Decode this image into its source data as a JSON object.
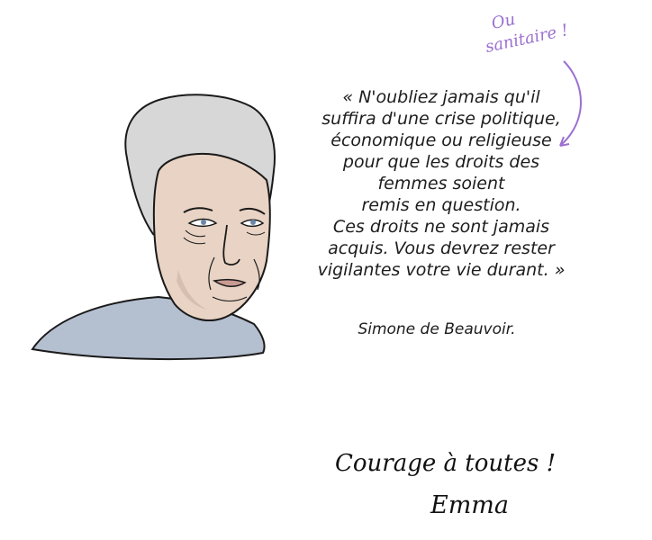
{
  "annotation": {
    "line1": "Ou",
    "line2": "sanitaire !"
  },
  "quote": {
    "lines": [
      "« N'oubliez jamais qu'il",
      "suffira d'une crise politique,",
      "économique ou religieuse",
      "pour que les droits des",
      "femmes soient",
      "remis en question.",
      "Ces droits ne sont jamais",
      "acquis. Vous devrez rester",
      "vigilantes votre vie durant. »"
    ],
    "author": "Simone de Beauvoir."
  },
  "closing": {
    "message": "Courage à toutes !",
    "signature": "Emma"
  },
  "colors": {
    "annotation": "#9b6fd1",
    "hair": "#d7d7d7",
    "skin": "#e8d3c4",
    "shirt": "#b4bfd0",
    "ink": "#1d1d1d"
  }
}
